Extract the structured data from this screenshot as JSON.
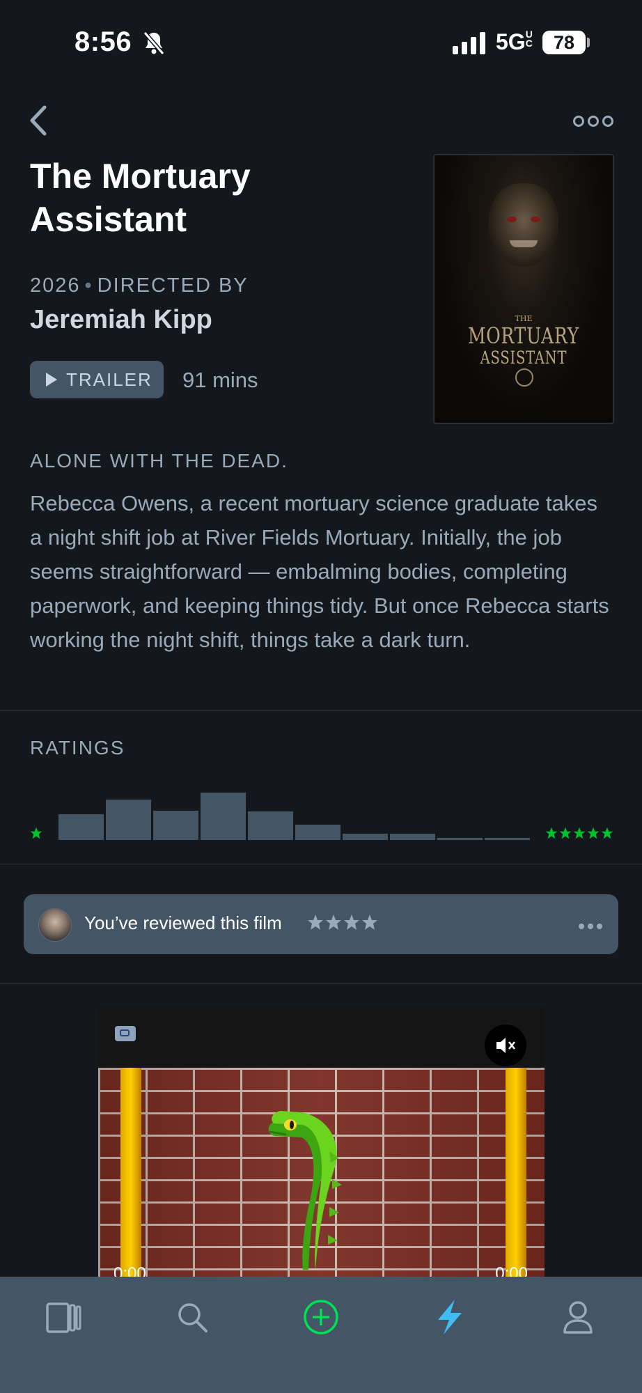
{
  "status_bar": {
    "time": "8:56",
    "network": "5G",
    "network_suffix": "UC",
    "battery": "78"
  },
  "film": {
    "title": "The Mortuary Assistant",
    "year": "2026",
    "directed_by_label": "DIRECTED BY",
    "director": "Jeremiah Kipp",
    "trailer_label": "TRAILER",
    "runtime": "91 mins",
    "tagline": "ALONE WITH THE DEAD.",
    "synopsis": "Rebecca Owens, a recent mortuary science graduate takes a night shift job at River Fields Mortuary. Initially, the job seems straightforward — embalming bodies, completing paperwork, and keeping things tidy. But once Rebecca starts working the night shift, things take a dark turn."
  },
  "poster": {
    "the": "THE",
    "line1": "MORTUARY",
    "line2": "ASSISTANT"
  },
  "ratings": {
    "label": "RATINGS",
    "histogram": [
      0.43,
      0.68,
      0.49,
      0.79,
      0.48,
      0.26,
      0.1,
      0.1,
      0.03,
      0.03
    ],
    "accent_color": "#00c030",
    "bar_color": "#445566"
  },
  "review": {
    "text": "You’ve reviewed this film",
    "stars": 4
  },
  "ad": {
    "time_left": "0:00",
    "time_right": "0:00"
  },
  "tab_bar": {
    "items": [
      "films-icon",
      "search-icon",
      "add-icon",
      "activity-icon",
      "profile-icon"
    ],
    "active": "activity-icon"
  },
  "colors": {
    "background": "#14181c",
    "muted_text": "#99aabb",
    "active_tab": "#40bcf4",
    "add_green": "#00e054"
  }
}
